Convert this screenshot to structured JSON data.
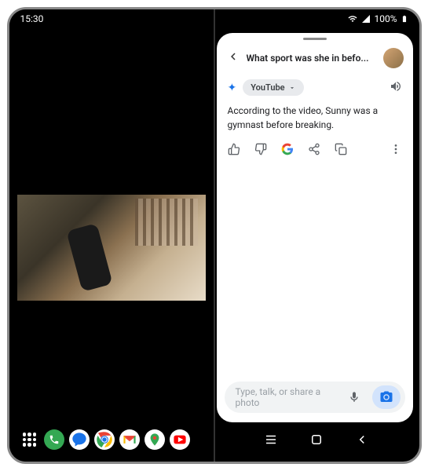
{
  "status": {
    "time": "15:30",
    "battery": "100%"
  },
  "panel": {
    "title": "What sport was she in befo...",
    "chip_label": "YouTube",
    "response": "According to the video, Sunny was a gymnast before breaking.",
    "input_placeholder": "Type, talk, or share a photo"
  }
}
